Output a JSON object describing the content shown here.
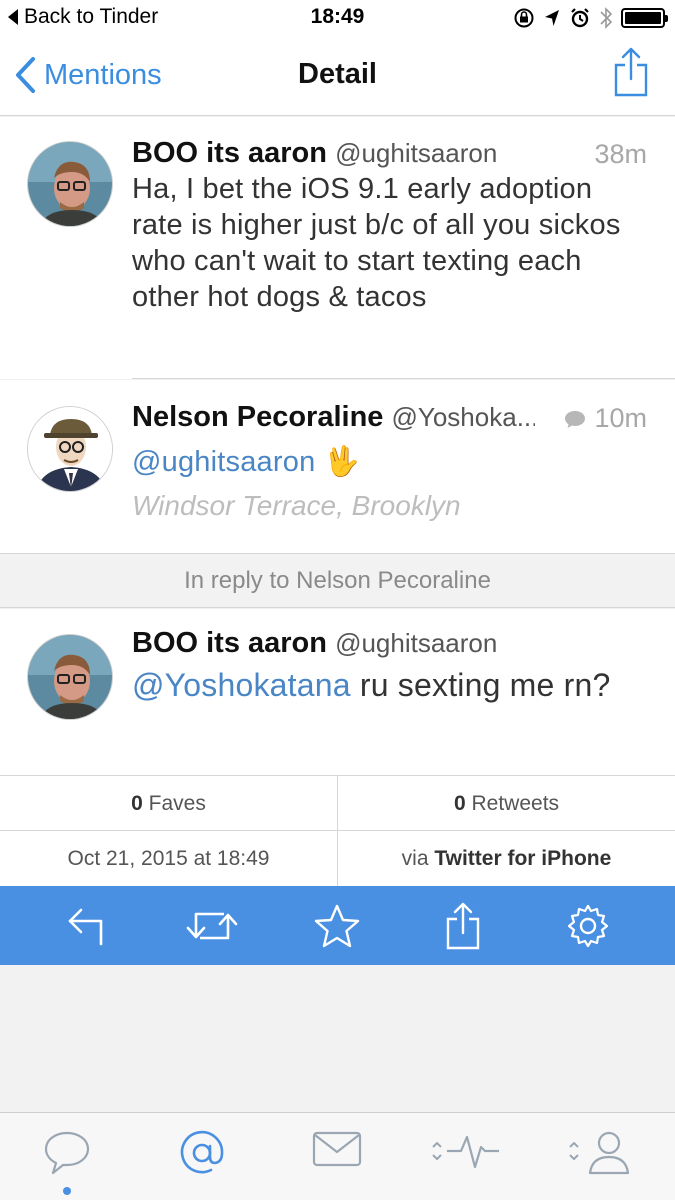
{
  "status_bar": {
    "back_app": "Back to Tinder",
    "time": "18:49"
  },
  "nav": {
    "back_label": "Mentions",
    "title": "Detail"
  },
  "tweets": [
    {
      "name": "BOO its aaron",
      "handle": "@ughitsaaron",
      "time": "38m",
      "text": "Ha, I bet the iOS 9.1 early adoption rate is higher just b/c of all you sickos who can't wait to start texting each other hot dogs & tacos"
    },
    {
      "name": "Nelson Pecoraline",
      "handle": "@Yoshoka...",
      "time": "10m",
      "mention": "@ughitsaaron",
      "emoji": "🖖",
      "location": "Windsor Terrace, Brooklyn"
    },
    {
      "name": "BOO its aaron",
      "handle": "@ughitsaaron",
      "mention": "@Yoshokatana",
      "text_after_mention": " ru sexting me rn?"
    }
  ],
  "reply_banner": "In reply to Nelson Pecoraline",
  "stats": {
    "faves_count": "0",
    "faves_label": " Faves",
    "retweets_count": "0",
    "retweets_label": " Retweets",
    "date": "Oct 21, 2015 at 18:49",
    "via_prefix": "via ",
    "via_client": "Twitter for iPhone"
  },
  "colors": {
    "accent": "#4a90e2",
    "link": "#4a86c5",
    "nav_blue": "#3b8de0"
  },
  "icons": {
    "actions": [
      "reply-icon",
      "retweet-icon",
      "favorite-icon",
      "share-icon",
      "settings-icon"
    ],
    "tabs": [
      "timeline-icon",
      "mentions-icon",
      "messages-icon",
      "activity-icon",
      "profile-icon"
    ]
  }
}
